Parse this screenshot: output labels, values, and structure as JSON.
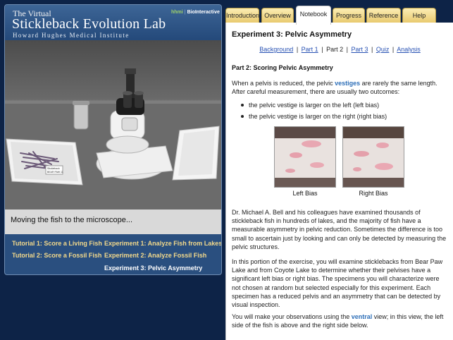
{
  "lab": {
    "pre_title": "The Virtual",
    "title": "Stickleback Evolution Lab",
    "subtitle": "Howard Hughes Medical Institute",
    "logo_hhmi": "hhmi",
    "logo_sep": "|",
    "logo_bio": "BioInteractive"
  },
  "scene": {
    "slide_label_line1": "Stickleback",
    "slide_label_line2": "BEAR PAW 11",
    "caption": "Moving the fish to the microscope..."
  },
  "nav": {
    "tutorial1": "Tutorial 1: Score a Living Fish",
    "tutorial2": "Tutorial 2: Score a Fossil Fish",
    "experiment1": "Experiment 1: Analyze Fish from Lakes",
    "experiment2": "Experiment 2: Analyze Fossil Fish",
    "experiment3": "Experiment 3: Pelvic Asymmetry"
  },
  "tabs": {
    "introduction": "Introduction",
    "overview": "Overview",
    "notebook": "Notebook",
    "progress": "Progress",
    "reference": "Reference",
    "help": "Help",
    "active": "Notebook"
  },
  "content": {
    "title": "Experiment 3: Pelvic Asymmetry",
    "breadcrumb": {
      "background": "Background",
      "part1": "Part 1",
      "part2": "Part 2",
      "part3": "Part 3",
      "quiz": "Quiz",
      "analysis": "Analysis",
      "separator": "|"
    },
    "part_title": "Part 2: Scoring Pelvic Asymmetry",
    "intro_before": "When a pelvis is reduced, the pelvic ",
    "intro_keyword": "vestiges",
    "intro_after": " are rarely the same length. After careful measurement, there are usually two outcomes:",
    "bullets": [
      "the pelvic vestige is larger on the left (left bias)",
      "the pelvic vestige is larger on the right (right bias)"
    ],
    "photo_left_label": "Left Bias",
    "photo_right_label": "Right Bias",
    "para2": "Dr. Michael A. Bell and his colleagues have examined thousands of stickleback fish in hundreds of lakes, and the majority of fish have a measurable asymmetry in pelvic reduction. Sometimes the difference is too small to ascertain just by looking and can only be detected by measuring the pelvic structures.",
    "para3": "In this portion of the exercise, you will examine sticklebacks from Bear Paw Lake and from Coyote Lake to determine whether their pelvises have a significant left bias or right bias. The specimens you will characterize were not chosen at random but selected especially for this experiment. Each specimen has a reduced pelvis and an asymmetry that can be detected by visual inspection.",
    "para4_before": "You will make your observations using the ",
    "para4_keyword": "ventral",
    "para4_after": " view; in this view, the left side of the fish is above and the right side below."
  },
  "colors": {
    "background": "#0d2347",
    "panel": "#2a4f7f",
    "nav_link": "#f3d98b",
    "tab": "#efd27e",
    "link": "#2751b3",
    "keyword": "#2e6fb8"
  },
  "icons": {
    "scene": "microscope-lab-scene"
  }
}
